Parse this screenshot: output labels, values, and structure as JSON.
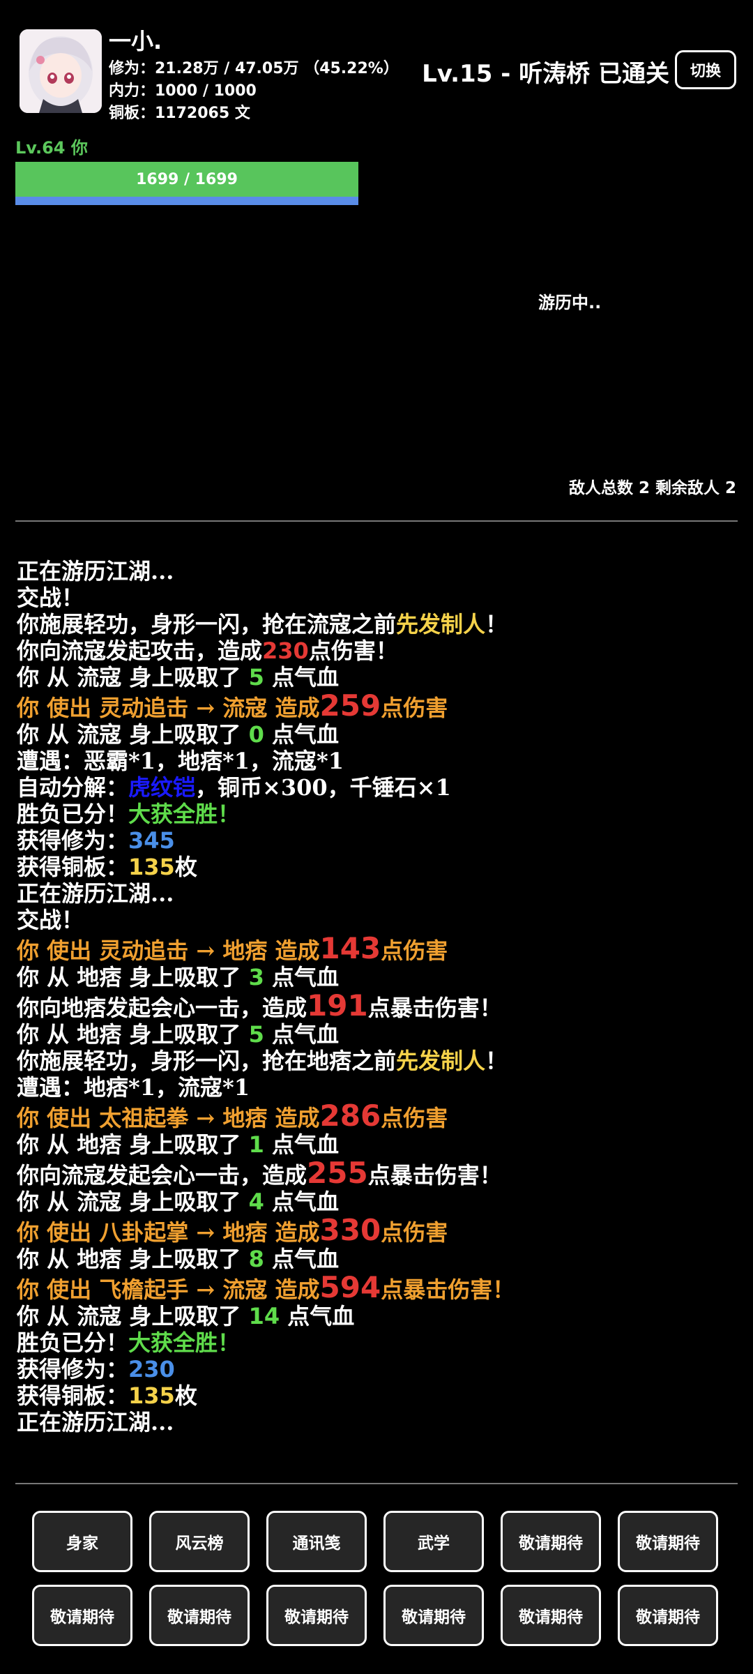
{
  "player": {
    "name": "一小.",
    "cultivation": "修为：21.28万 / 47.05万 （45.22%）",
    "inner_power": "内力：1000 / 1000",
    "copper": "铜板：1172065 文",
    "level_label": "Lv.64 你",
    "hp_text": "1699 / 1699",
    "hp_fraction": 1.0
  },
  "stage": {
    "title": "Lv.15 - 听涛桥 已通关",
    "switch_label": "切换",
    "status": "游历中..",
    "enemy_info": "敌人总数 2 剩余敌人 2"
  },
  "log": [
    [
      {
        "t": "正在游历江湖..."
      }
    ],
    [
      {
        "t": "交战！"
      }
    ],
    [
      {
        "t": "你施展轻功，身形一闪，抢在流寇之前"
      },
      {
        "t": "先发制人",
        "c": "yellow"
      },
      {
        "t": "！"
      }
    ],
    [
      {
        "t": "你向流寇发起攻击，造成"
      },
      {
        "t": "230",
        "c": "red num"
      },
      {
        "t": "点伤害！"
      }
    ],
    [
      {
        "t": "你 从 流寇 身上吸取了 "
      },
      {
        "t": "5",
        "c": "green num"
      },
      {
        "t": " 点气血"
      }
    ],
    [
      {
        "t": "你 使出 灵动追击 → 流寇 造成",
        "c": "orange"
      },
      {
        "t": "259",
        "c": "bigred"
      },
      {
        "t": "点伤害",
        "c": "orange"
      }
    ],
    [
      {
        "t": "你 从 流寇 身上吸取了 "
      },
      {
        "t": "0",
        "c": "green num"
      },
      {
        "t": " 点气血"
      }
    ],
    [
      {
        "t": "遭遇：恶霸*1，地痞*1，流寇*1"
      }
    ],
    [
      {
        "t": "自动分解："
      },
      {
        "t": "虎纹铠",
        "c": "darkblue"
      },
      {
        "t": "，铜币×300，千锤石×1"
      }
    ],
    [
      {
        "t": "胜负已分！"
      },
      {
        "t": "大获全胜！",
        "c": "green"
      }
    ],
    [
      {
        "t": "获得修为："
      },
      {
        "t": "345",
        "c": "blue num"
      }
    ],
    [
      {
        "t": "获得铜板："
      },
      {
        "t": "135",
        "c": "yellow num"
      },
      {
        "t": "枚"
      }
    ],
    [
      {
        "t": "正在游历江湖..."
      }
    ],
    [
      {
        "t": "交战！"
      }
    ],
    [
      {
        "t": "你 使出 灵动追击 → 地痞 造成",
        "c": "orange"
      },
      {
        "t": "143",
        "c": "bigred"
      },
      {
        "t": "点伤害",
        "c": "orange"
      }
    ],
    [
      {
        "t": "你 从 地痞 身上吸取了 "
      },
      {
        "t": "3",
        "c": "green num"
      },
      {
        "t": " 点气血"
      }
    ],
    [
      {
        "t": "你向地痞发起会心一击，造成"
      },
      {
        "t": "191",
        "c": "bigred"
      },
      {
        "t": "点暴击伤害！"
      }
    ],
    [
      {
        "t": "你 从 地痞 身上吸取了 "
      },
      {
        "t": "5",
        "c": "green num"
      },
      {
        "t": " 点气血"
      }
    ],
    [
      {
        "t": "你施展轻功，身形一闪，抢在地痞之前"
      },
      {
        "t": "先发制人",
        "c": "yellow"
      },
      {
        "t": "！"
      }
    ],
    [
      {
        "t": "遭遇：地痞*1，流寇*1"
      }
    ],
    [
      {
        "t": "你 使出 太祖起拳 → 地痞 造成",
        "c": "orange"
      },
      {
        "t": "286",
        "c": "bigred"
      },
      {
        "t": "点伤害",
        "c": "orange"
      }
    ],
    [
      {
        "t": "你 从 地痞 身上吸取了 "
      },
      {
        "t": "1",
        "c": "green num"
      },
      {
        "t": " 点气血"
      }
    ],
    [
      {
        "t": "你向流寇发起会心一击，造成"
      },
      {
        "t": "255",
        "c": "bigred"
      },
      {
        "t": "点暴击伤害！"
      }
    ],
    [
      {
        "t": "你 从 流寇 身上吸取了 "
      },
      {
        "t": "4",
        "c": "green num"
      },
      {
        "t": " 点气血"
      }
    ],
    [
      {
        "t": "你 使出 八卦起掌 → 地痞 造成",
        "c": "orange"
      },
      {
        "t": "330",
        "c": "bigred"
      },
      {
        "t": "点伤害",
        "c": "orange"
      }
    ],
    [
      {
        "t": "你 从 地痞 身上吸取了 "
      },
      {
        "t": "8",
        "c": "green num"
      },
      {
        "t": " 点气血"
      }
    ],
    [
      {
        "t": "你 使出 飞檐起手 → 流寇 造成",
        "c": "orange"
      },
      {
        "t": "594",
        "c": "bigred"
      },
      {
        "t": "点暴击伤害！",
        "c": "orange"
      }
    ],
    [
      {
        "t": "你 从 流寇 身上吸取了 "
      },
      {
        "t": "14",
        "c": "green num"
      },
      {
        "t": " 点气血"
      }
    ],
    [
      {
        "t": "胜负已分！"
      },
      {
        "t": "大获全胜！",
        "c": "green"
      }
    ],
    [
      {
        "t": "获得修为："
      },
      {
        "t": "230",
        "c": "blue num"
      }
    ],
    [
      {
        "t": "获得铜板："
      },
      {
        "t": "135",
        "c": "yellow num"
      },
      {
        "t": "枚"
      }
    ],
    [
      {
        "t": "正在游历江湖..."
      }
    ]
  ],
  "menu": [
    "身家",
    "风云榜",
    "通讯笺",
    "武学",
    "敬请期待",
    "敬请期待",
    "敬请期待",
    "敬请期待",
    "敬请期待",
    "敬请期待",
    "敬请期待",
    "敬请期待"
  ],
  "colors": {
    "hp_green": "#58c55c",
    "hp_blue": "#5a8de8",
    "damage_red": "#e53935",
    "skill_orange": "#f0a030"
  }
}
